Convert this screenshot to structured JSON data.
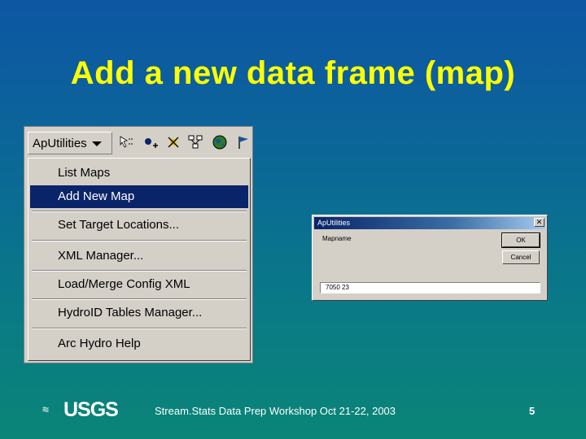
{
  "slide": {
    "title": "Add a new data frame (map)",
    "footer": "Stream.Stats Data Prep Workshop  Oct 21-22, 2003",
    "page_number": "5",
    "logo_text": "USGS"
  },
  "toolbar": {
    "dropdown_label": "ApUtilities",
    "icons": [
      "select-tool-icon",
      "add-point-icon",
      "delete-point-icon",
      "network-icon",
      "globe-icon",
      "flag-icon"
    ]
  },
  "menu": {
    "items": [
      {
        "label": "List Maps",
        "selected": false
      },
      {
        "label": "Add New Map",
        "selected": true
      },
      {
        "label": "Set Target Locations...",
        "selected": false
      },
      {
        "label": "XML Manager...",
        "selected": false
      },
      {
        "label": "Load/Merge Config XML",
        "selected": false
      },
      {
        "label": "HydroID Tables Manager...",
        "selected": false
      },
      {
        "label": "Arc Hydro Help",
        "selected": false
      }
    ]
  },
  "dialog": {
    "title": "ApUtilities",
    "field_label": "Mapname",
    "ok_label": "OK",
    "cancel_label": "Cancel",
    "input_value": "7050 23"
  },
  "colors": {
    "title": "#ffff00",
    "selection": "#0a246a",
    "background_top": "#0d56a3",
    "background_bottom": "#0a8577"
  }
}
